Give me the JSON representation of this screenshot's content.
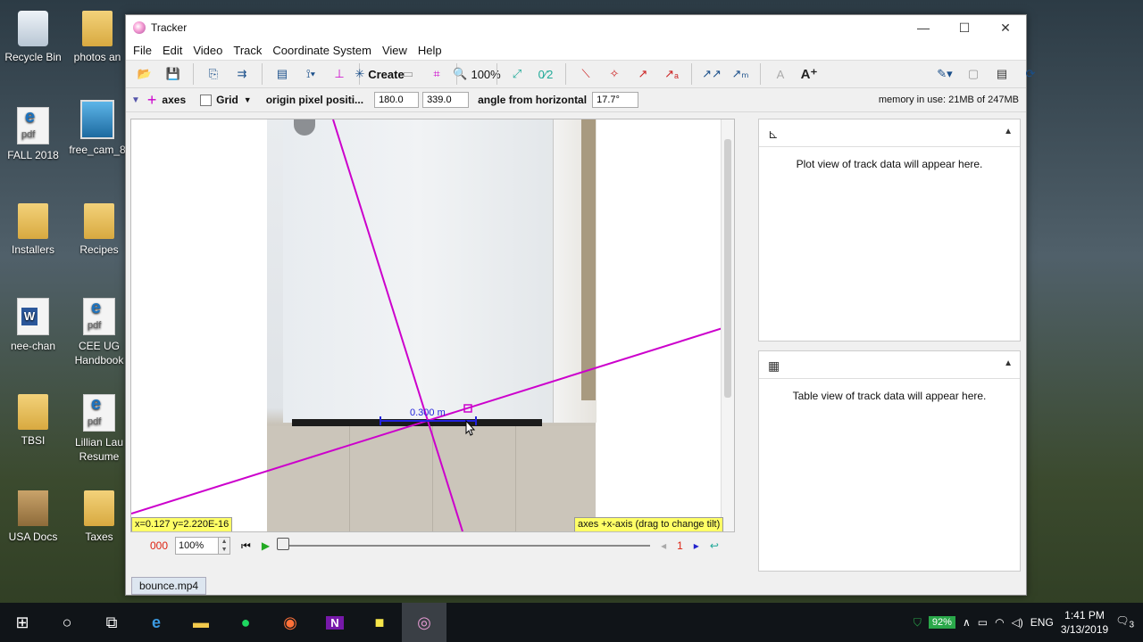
{
  "desktop": {
    "icons": [
      {
        "label": "Recycle Bin"
      },
      {
        "label": "photos an"
      },
      {
        "label": "FALL 2018"
      },
      {
        "label": "free_cam_8"
      },
      {
        "label": "Installers"
      },
      {
        "label": "Recipes"
      },
      {
        "label": "nee-chan"
      },
      {
        "label": "CEE UG Handbook"
      },
      {
        "label": "TBSI"
      },
      {
        "label": "Lillian Lau Resume"
      },
      {
        "label": "USA Docs"
      },
      {
        "label": "Taxes"
      }
    ]
  },
  "window": {
    "title": "Tracker",
    "controls": {
      "minimize": "—",
      "maximize": "☐",
      "close": "✕"
    }
  },
  "menu": [
    "File",
    "Edit",
    "Video",
    "Track",
    "Coordinate System",
    "View",
    "Help"
  ],
  "toolbar": {
    "create_label": "Create",
    "zoom_label": "100%",
    "memory": "memory in use: 21MB of 247MB"
  },
  "axes_bar": {
    "axes_label": "axes",
    "grid_label": "Grid",
    "origin_label": "origin pixel positi...",
    "origin_x": "180.0",
    "origin_y": "339.0",
    "angle_label": "angle from horizontal",
    "angle_value": "17.7°"
  },
  "video": {
    "calibration_label": "0.300 m",
    "coords_readout": "x=0.127  y=2.220E-16",
    "hint": "axes +x-axis (drag to change tilt)"
  },
  "player": {
    "frame_count": "000",
    "rate": "100%",
    "step": "1"
  },
  "file_tab": "bounce.mp4",
  "plot_panel": {
    "message": "Plot view of track data will appear here."
  },
  "table_panel": {
    "message": "Table view of track data will appear here."
  },
  "taskbar": {
    "battery": "92%",
    "lang": "ENG",
    "time": "1:41 PM",
    "date": "3/13/2019",
    "notifications": "3"
  },
  "colors": {
    "axes": "#cc00cc",
    "calibration": "#2222dd",
    "readout_bg": "#ffff66"
  }
}
